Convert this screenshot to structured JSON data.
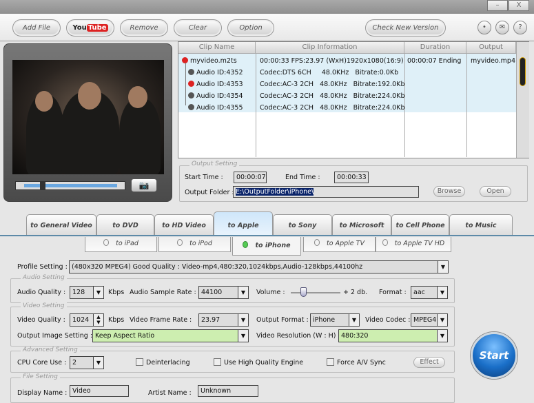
{
  "window": {
    "minimize": "–",
    "close": "X"
  },
  "toolbar": {
    "add_file": "Add File",
    "youtube_you": "You",
    "youtube_tube": "Tube",
    "remove": "Remove",
    "clear": "Clear",
    "option": "Option",
    "check_new_version": "Check New Version",
    "icons": [
      "account-icon",
      "mail-icon",
      "help-icon"
    ],
    "help": "?"
  },
  "preview": {
    "slider_position": 0.2,
    "snapshot_icon": "camera-icon"
  },
  "clip_list": {
    "headers": [
      "Clip Name",
      "Clip Information",
      "Duration",
      "Output"
    ],
    "rows": [
      {
        "name": "myvideo.m2ts",
        "info": "00:00:33  FPS:23.97  (WxH)1920x1080(16:9)",
        "duration": "00:00:07  Ending",
        "output": "myvideo.mp4",
        "selected": true
      },
      {
        "name": "Audio ID:4352",
        "info": "Codec:DTS 6CH     48.0KHz   Bitrate:0.0Kb",
        "selected": false
      },
      {
        "name": "Audio ID:4353",
        "info": "Codec:AC-3 2CH   48.0KHz   Bitrate:192.0Kb",
        "selected": true
      },
      {
        "name": "Audio ID:4354",
        "info": "Codec:AC-3 2CH   48.0KHz   Bitrate:224.0Kb",
        "selected": false
      },
      {
        "name": "Audio ID:4355",
        "info": "Codec:AC-3 2CH   48.0KHz   Bitrate:224.0Kb",
        "selected": false
      }
    ]
  },
  "output_setting": {
    "title": "Output Setting",
    "start_label": "Start Time :",
    "start": "00:00:07",
    "end_label": "End Time :",
    "end": "00:00:33",
    "folder_label": "Output Folder :",
    "folder": "E:\\OutputFolder\\iPhone\\",
    "browse": "Browse",
    "open": "Open"
  },
  "tabs": [
    "to General Video",
    "to DVD",
    "to HD Video",
    "to Apple",
    "to Sony",
    "to Microsoft",
    "to Cell Phone",
    "to Music"
  ],
  "active_tab": "to Apple",
  "subtabs": [
    "to iPad",
    "to iPod",
    "to iPhone",
    "to Apple TV",
    "to Apple TV HD"
  ],
  "active_subtab": "to iPhone",
  "profile": {
    "label": "Profile Setting :",
    "value": "(480x320 MPEG4) Good Quality : Video-mp4,480:320,1024kbps,Audio-128kbps,44100hz"
  },
  "audio": {
    "title": "Audio Setting",
    "quality_label": "Audio Quality :",
    "quality": "128",
    "kbps": "Kbps",
    "rate_label": "Audio Sample Rate :",
    "rate": "44100",
    "volume_label": "Volume :",
    "volume": "+ 2 db.",
    "volume_level": 0.25,
    "format_label": "Format :",
    "format": "aac"
  },
  "video": {
    "title": "Video Setting",
    "quality_label": "Video Quality :",
    "quality": "1024",
    "kbps": "Kbps",
    "fps_label": "Video Frame Rate :",
    "fps": "23.97",
    "format_label": "Output Format :",
    "format": "iPhone",
    "codec_label": "Video Codec :",
    "codec": "MPEG4",
    "image_label": "Output Image Setting :",
    "image": "Keep Aspect Ratio",
    "res_label": "Video Resolution (W : H) :",
    "res": "480:320"
  },
  "advanced": {
    "title": "Advanced Setting",
    "cpu_label": "CPU Core Use :",
    "cpu": "2",
    "deinterlacing": "Deinterlacing",
    "hq": "Use High Quality Engine",
    "sync": "Force A/V Sync",
    "effect": "Effect"
  },
  "file": {
    "title": "File Setting",
    "display_label": "Display Name :",
    "display": "Video",
    "artist_label": "Artist Name :",
    "artist": "Unknown"
  },
  "start": "Start",
  "colors": {
    "selection": "#0a246a",
    "list_bg": "#dff0f8",
    "green_field": "#cdeeb0",
    "start_button": "#1a6fc8"
  }
}
